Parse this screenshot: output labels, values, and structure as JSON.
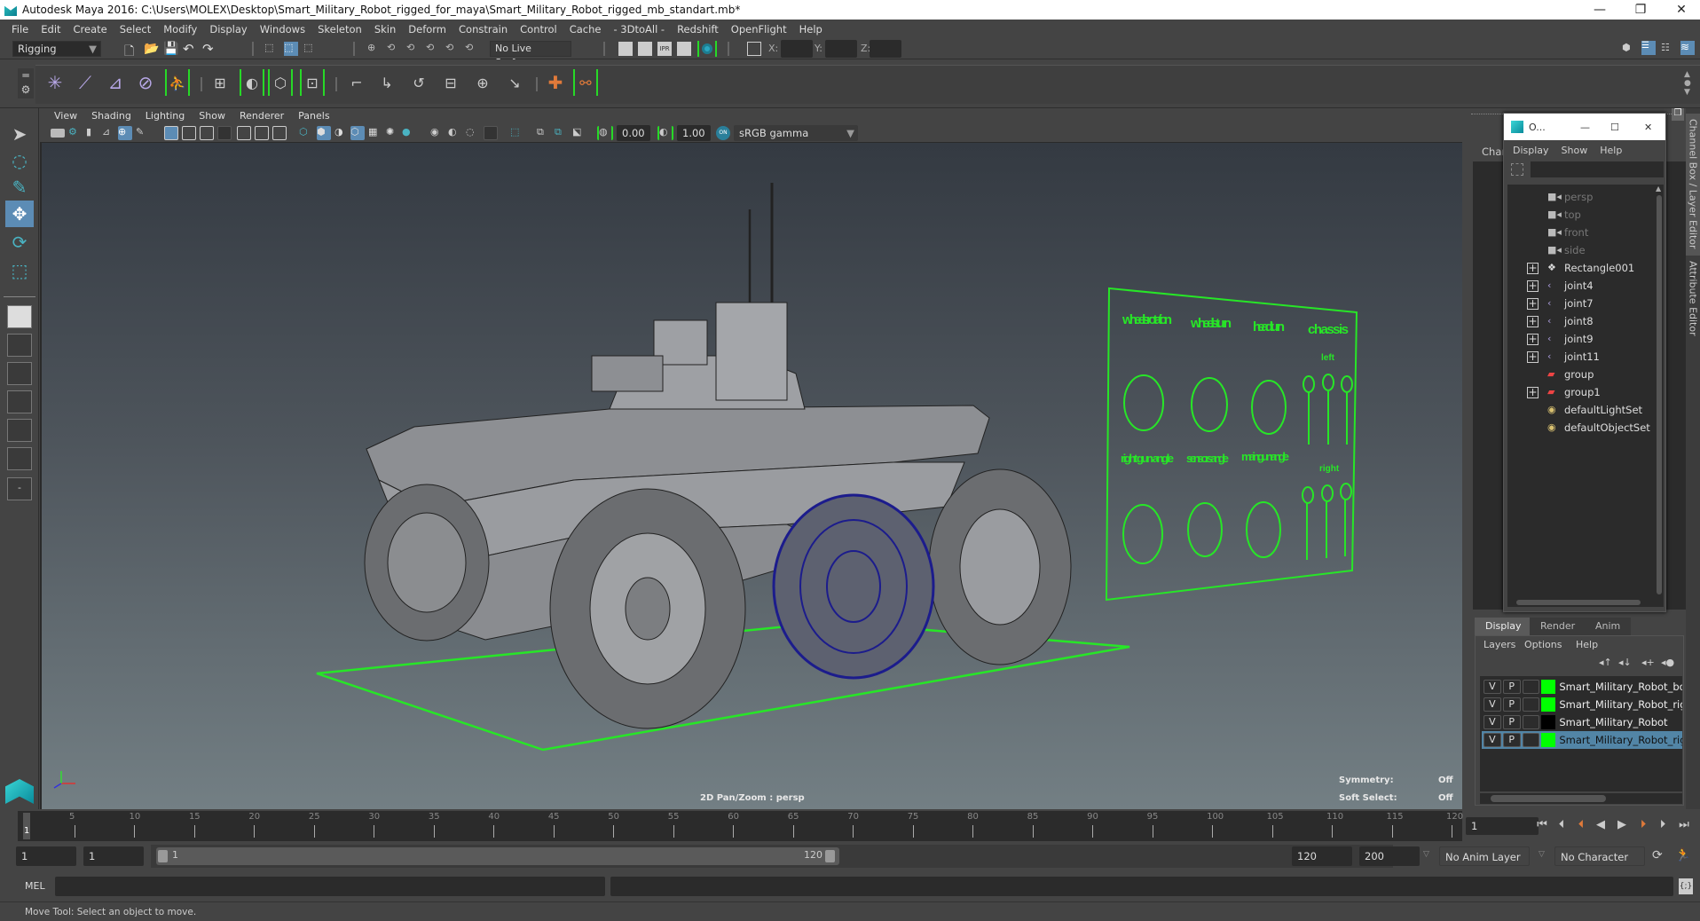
{
  "window": {
    "title": "Autodesk Maya 2016: C:\\Users\\MOLEX\\Desktop\\Smart_Military_Robot_rigged_for_maya\\Smart_Military_Robot_rigged_mb_standart.mb*",
    "minimize": "—",
    "restore": "❐",
    "close": "✕"
  },
  "menubar": [
    "File",
    "Edit",
    "Create",
    "Select",
    "Modify",
    "Display",
    "Windows",
    "Skeleton",
    "Skin",
    "Deform",
    "Constrain",
    "Control",
    "Cache",
    "- 3DtoAll -",
    "Redshift",
    "OpenFlight",
    "Help"
  ],
  "statusline": {
    "menuset": "Rigging",
    "live_surface": "No Live Surface",
    "x_label": "X:",
    "y_label": "Y:",
    "z_label": "Z:",
    "x_value": "",
    "y_value": "",
    "z_value": ""
  },
  "viewport": {
    "menu": [
      "View",
      "Shading",
      "Lighting",
      "Show",
      "Renderer",
      "Panels"
    ],
    "exposure": "0.00",
    "gamma": "1.00",
    "color_space": "sRGB gamma",
    "camera_label": "2D Pan/Zoom : persp",
    "symmetry_label": "Symmetry:",
    "symmetry_value": "Off",
    "soft_select_label": "Soft Select:",
    "soft_select_value": "Off",
    "control_board": {
      "labels": [
        "wheels rotation",
        "wheels turn",
        "head turn",
        "chassis",
        "left",
        "right gun angle",
        "sensors angle",
        "main gun angle",
        "right"
      ]
    }
  },
  "outliner": {
    "title": "O...",
    "menu": [
      "Display",
      "Show",
      "Help"
    ],
    "search_value": "",
    "items": [
      {
        "label": "persp",
        "icon": "camera-icon",
        "expandable": false,
        "dim": true
      },
      {
        "label": "top",
        "icon": "camera-icon",
        "expandable": false,
        "dim": true
      },
      {
        "label": "front",
        "icon": "camera-icon",
        "expandable": false,
        "dim": true
      },
      {
        "label": "side",
        "icon": "camera-icon",
        "expandable": false,
        "dim": true
      },
      {
        "label": "Rectangle001",
        "icon": "mesh-icon",
        "expandable": true,
        "dim": false
      },
      {
        "label": "joint4",
        "icon": "joint-icon",
        "expandable": true,
        "dim": false
      },
      {
        "label": "joint7",
        "icon": "joint-icon",
        "expandable": true,
        "dim": false
      },
      {
        "label": "joint8",
        "icon": "joint-icon",
        "expandable": true,
        "dim": false
      },
      {
        "label": "joint9",
        "icon": "joint-icon",
        "expandable": true,
        "dim": false
      },
      {
        "label": "joint11",
        "icon": "joint-icon",
        "expandable": true,
        "dim": false
      },
      {
        "label": "group",
        "icon": "group-icon",
        "expandable": false,
        "dim": false
      },
      {
        "label": "group1",
        "icon": "group-icon",
        "expandable": true,
        "dim": false
      },
      {
        "label": "defaultLightSet",
        "icon": "set-icon",
        "expandable": false,
        "dim": false
      },
      {
        "label": "defaultObjectSet",
        "icon": "set-icon",
        "expandable": false,
        "dim": false
      }
    ]
  },
  "channel_box": {
    "header": "Chan"
  },
  "side_tabs": [
    "Channel Box / Layer Editor",
    "Attribute Editor"
  ],
  "layer_editor": {
    "tabs": [
      "Display",
      "Render",
      "Anim"
    ],
    "active_tab": "Display",
    "menu": [
      "Layers",
      "Options",
      "Help"
    ],
    "layers": [
      {
        "v": "V",
        "p": "P",
        "color": "#00ff00",
        "name": "Smart_Military_Robot_bon",
        "selected": false
      },
      {
        "v": "V",
        "p": "P",
        "color": "#00ff00",
        "name": "Smart_Military_Robot_rigg",
        "selected": false
      },
      {
        "v": "V",
        "p": "P",
        "color": "#000000",
        "name": "Smart_Military_Robot",
        "selected": false
      },
      {
        "v": "V",
        "p": "P",
        "color": "#00ff00",
        "name": "Smart_Military_Robot_rigg",
        "selected": true
      }
    ]
  },
  "timeline": {
    "ticks": [
      5,
      10,
      15,
      20,
      25,
      30,
      35,
      40,
      45,
      50,
      55,
      60,
      65,
      70,
      75,
      80,
      85,
      90,
      95,
      100,
      105,
      110,
      115,
      120
    ],
    "current_frame_marker": "1",
    "current_frame": "1",
    "range_start": 1,
    "range_end": 120
  },
  "range": {
    "start_time": "1",
    "playback_start": "1",
    "slider_start_label": "1",
    "slider_end_label": "120",
    "playback_end": "120",
    "end_time": "200",
    "anim_layer": "No Anim Layer",
    "character_set": "No Character Set"
  },
  "command_line": {
    "label": "MEL",
    "value": "",
    "result": ""
  },
  "help_line": "Move Tool: Select an object to move.",
  "colors": {
    "accent": "#5c8cb5",
    "selection_green": "#27e627",
    "selected_wheel": "#1c1c8c",
    "layer_highlight": "#5285a6",
    "playback_orange": "#e07a3a"
  }
}
